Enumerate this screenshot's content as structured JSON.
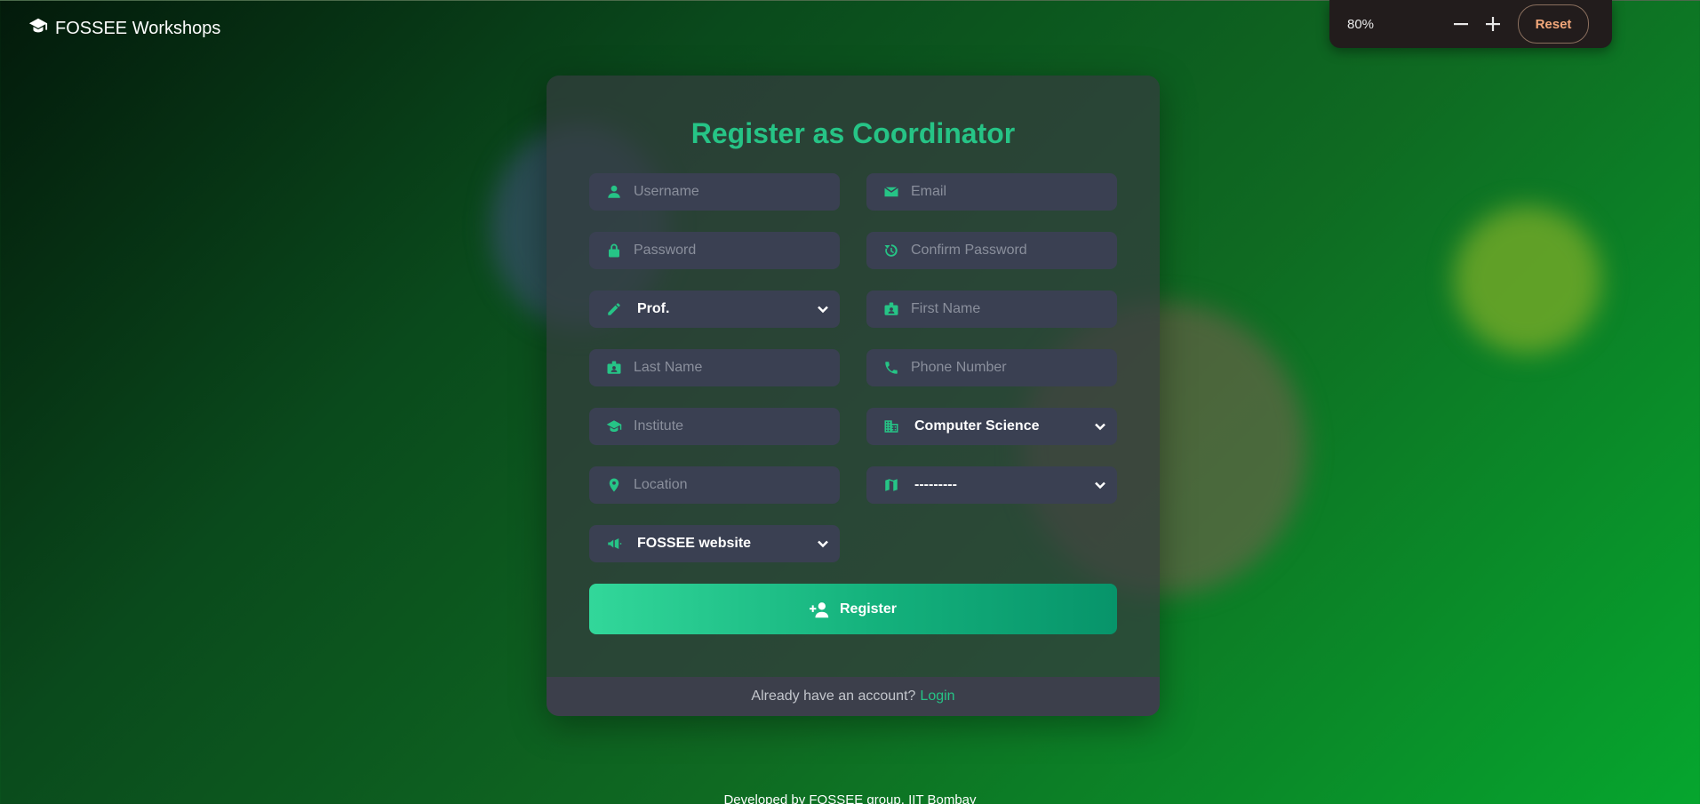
{
  "app": {
    "brand": "FOSSEE Workshops"
  },
  "zoom": {
    "value": "80%",
    "minus_label": "−",
    "plus_label": "+",
    "reset_label": "Reset"
  },
  "form": {
    "title": "Register as Coordinator",
    "fields": {
      "username": {
        "placeholder": "Username",
        "icon": "user-icon"
      },
      "email": {
        "placeholder": "Email",
        "icon": "envelope-icon"
      },
      "password": {
        "placeholder": "Password",
        "icon": "lock-icon"
      },
      "confirm_password": {
        "placeholder": "Confirm Password",
        "icon": "history-icon"
      },
      "title_select": {
        "value": "Prof.",
        "icon": "pencil-icon"
      },
      "first_name": {
        "placeholder": "First Name",
        "icon": "id-badge-icon"
      },
      "last_name": {
        "placeholder": "Last Name",
        "icon": "id-badge-icon"
      },
      "phone": {
        "placeholder": "Phone Number",
        "icon": "phone-icon"
      },
      "institute": {
        "placeholder": "Institute",
        "icon": "graduation-cap-icon"
      },
      "department": {
        "value": "Computer Science",
        "icon": "building-icon"
      },
      "location": {
        "placeholder": "Location",
        "icon": "map-pin-icon"
      },
      "state": {
        "value": "---------",
        "icon": "map-icon"
      },
      "source": {
        "value": "FOSSEE website",
        "icon": "megaphone-icon"
      }
    },
    "register_label": "Register",
    "footer_text": "Already have an account?",
    "login_label": "Login"
  },
  "page_footer": "Developed by FOSSEE group, IIT Bombay",
  "colors": {
    "accent": "#26c486",
    "field_bg": "#3a4052",
    "reset_text": "#f2a77a"
  }
}
